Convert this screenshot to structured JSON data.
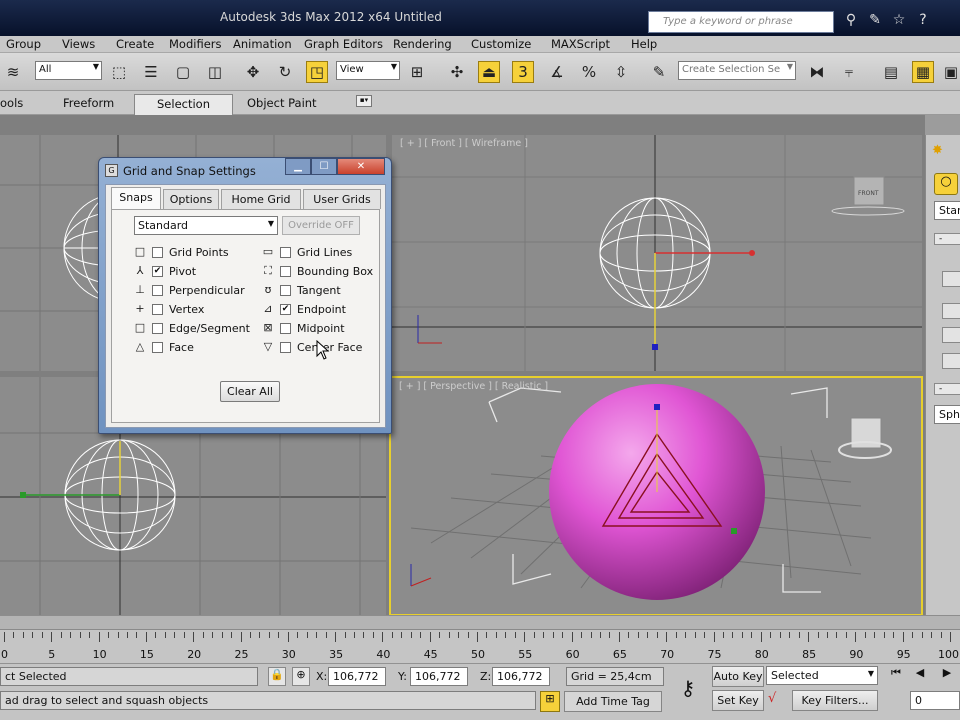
{
  "window": {
    "title": "Autodesk 3ds Max 2012 x64        Untitled"
  },
  "search": {
    "placeholder": "Type a keyword or phrase"
  },
  "menubar": {
    "items": [
      "Group",
      "Views",
      "Create",
      "Modifiers",
      "Animation",
      "Graph Editors",
      "Rendering",
      "Customize",
      "MAXScript",
      "Help"
    ]
  },
  "toolbar": {
    "selection_filter": "All",
    "reference_coord": "View",
    "snap_toggle_label": "3",
    "selection_set_placeholder": "Create Selection Se"
  },
  "ribbon": {
    "tabs": [
      "ools",
      "Freeform",
      "Selection",
      "Object Paint"
    ]
  },
  "viewports": {
    "front_label": "[ + ] [ Front ] [ Wireframe ]",
    "perspective_label": "[ + ] [ Perspective ] [ Realistic ]",
    "viewcube_label": "FRONT"
  },
  "command_panel": {
    "field1": "Stan",
    "field2": "Sph"
  },
  "dialog": {
    "title": "Grid and Snap Settings",
    "tabs": [
      "Snaps",
      "Options",
      "Home Grid",
      "User Grids"
    ],
    "preset": "Standard",
    "override": "Override OFF",
    "snaps_left": [
      {
        "label": "Grid Points",
        "checked": false,
        "icon": "grid-points-icon",
        "glyph": "□"
      },
      {
        "label": "Pivot",
        "checked": true,
        "icon": "pivot-icon",
        "glyph": "⅄"
      },
      {
        "label": "Perpendicular",
        "checked": false,
        "icon": "perpendicular-icon",
        "glyph": "⊥"
      },
      {
        "label": "Vertex",
        "checked": false,
        "icon": "vertex-icon",
        "glyph": "+"
      },
      {
        "label": "Edge/Segment",
        "checked": false,
        "icon": "edge-icon",
        "glyph": "□"
      },
      {
        "label": "Face",
        "checked": false,
        "icon": "face-icon",
        "glyph": "△"
      }
    ],
    "snaps_right": [
      {
        "label": "Grid Lines",
        "checked": false,
        "icon": "grid-lines-icon",
        "glyph": "▭"
      },
      {
        "label": "Bounding Box",
        "checked": false,
        "icon": "bounding-box-icon",
        "glyph": "⛶"
      },
      {
        "label": "Tangent",
        "checked": false,
        "icon": "tangent-icon",
        "glyph": "ʊ"
      },
      {
        "label": "Endpoint",
        "checked": true,
        "icon": "endpoint-icon",
        "glyph": "⊿"
      },
      {
        "label": "Midpoint",
        "checked": false,
        "icon": "midpoint-icon",
        "glyph": "⊠"
      },
      {
        "label": "Center Face",
        "checked": false,
        "icon": "center-face-icon",
        "glyph": "▽"
      }
    ],
    "clear_all": "Clear All"
  },
  "timeline": {
    "ticks": [
      "0",
      "5",
      "10",
      "15",
      "20",
      "25",
      "30",
      "35",
      "40",
      "45",
      "50",
      "55",
      "60",
      "65",
      "70",
      "75",
      "80",
      "85",
      "90",
      "95",
      "100"
    ]
  },
  "status": {
    "selection": "ct Selected",
    "prompt": "ad drag to select and squash objects",
    "x_label": "X:",
    "x_value": "106,772",
    "y_label": "Y:",
    "y_value": "106,772",
    "z_label": "Z:",
    "z_value": "106,772",
    "grid": "Grid = 25,4cm",
    "add_time_tag": "Add Time Tag",
    "auto_key": "Auto Key",
    "set_key": "Set Key",
    "key_mode": "Selected",
    "key_filters": "Key Filters...",
    "frame": "0"
  },
  "colors": {
    "accent": "#f6d13a",
    "sphere": "#e04fd0",
    "titlebar": "#0b1733"
  }
}
